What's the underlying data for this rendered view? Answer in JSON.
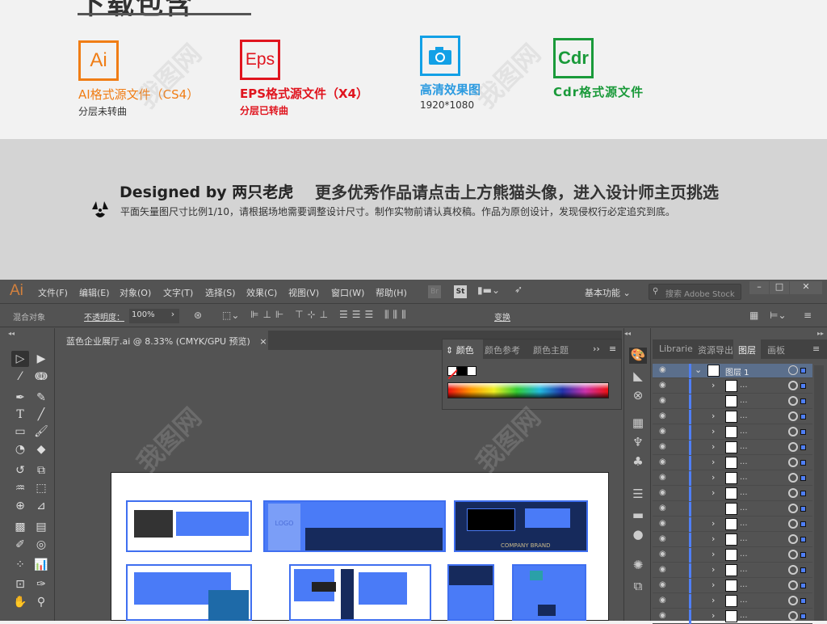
{
  "header": {
    "title": "下载包含"
  },
  "formats": [
    {
      "icon": "Ai",
      "icon_name": "ai-file-icon",
      "color": "#f07d15",
      "label": "AI格式源文件（CS4）",
      "sub": "分层未转曲",
      "sub_color": "#333333"
    },
    {
      "icon": "Eps",
      "icon_name": "eps-file-icon",
      "color": "#e0141e",
      "label": "EPS格式源文件（X4）",
      "sub": "分层已转曲",
      "sub_color": "#e0141e"
    },
    {
      "icon": "camera",
      "icon_name": "camera-icon",
      "color": "#12a0e6",
      "label": "高清效果图",
      "sub": "1920*1080",
      "sub_color": "#333333"
    },
    {
      "icon": "Cdr",
      "icon_name": "cdr-file-icon",
      "color": "#1a9a3a",
      "label": "Cdr格式源文件",
      "sub": "",
      "sub_color": "#333333"
    }
  ],
  "designer": {
    "by": "Designed by 两只老虎",
    "more": "更多优秀作品请点击上方熊猫头像，进入设计师主页挑选",
    "note": "平面矢量图尺寸比例1/10，请根据场地需要调整设计尺寸。制作实物前请认真校稿。作品为原创设计，发现侵权行必定追究到底。"
  },
  "app": {
    "logo": "Ai",
    "menu": [
      "文件(F)",
      "编辑(E)",
      "对象(O)",
      "文字(T)",
      "选择(S)",
      "效果(C)",
      "视图(V)",
      "窗口(W)",
      "帮助(H)"
    ],
    "bridge": "Br",
    "stock": "St",
    "workspace": "基本功能",
    "search_placeholder": "搜索 Adobe Stock",
    "window_controls": {
      "minimize": "–",
      "maximize": "□",
      "close": "✕"
    }
  },
  "control_bar": {
    "object_type": "混合对象",
    "opacity_label": "不透明度：",
    "opacity_value": "100%",
    "arrow": "›",
    "transform": "变换"
  },
  "document": {
    "tab_title": "蓝色企业展厅.ai @ 8.33% (CMYK/GPU 预览)",
    "close": "×"
  },
  "color_panel": {
    "tabs": [
      "颜色",
      "颜色参考",
      "颜色主题"
    ],
    "active_tab": "颜色",
    "more": "››",
    "menu": "≡"
  },
  "layers_panel": {
    "tabs": [
      "Librarie",
      "资源导出",
      "图层",
      "画板"
    ],
    "active_tab": "图层",
    "top_layer": "图层 1",
    "sublayer_label": "...",
    "rows": 17
  },
  "artboard": {
    "brand_text": "COMPANY BRAND",
    "logo_text": "LOGO"
  },
  "watermark": "我图网"
}
